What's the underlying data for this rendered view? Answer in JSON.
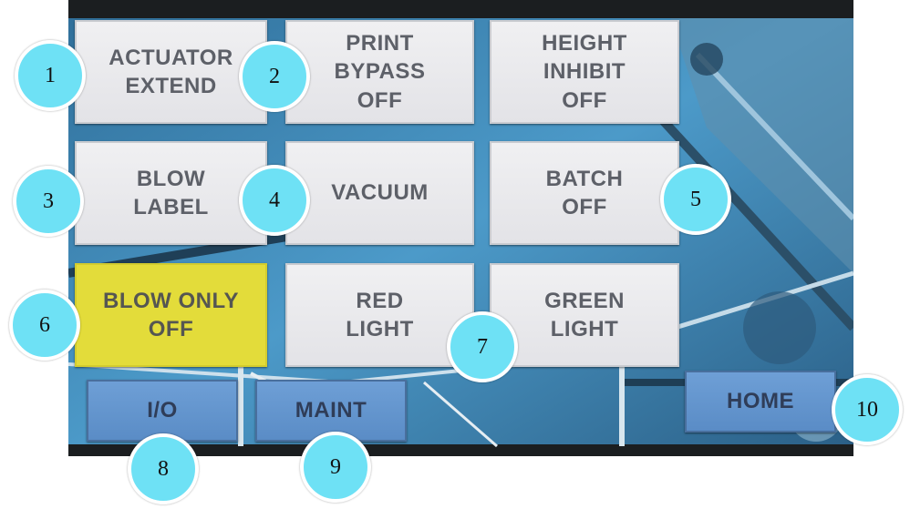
{
  "colors": {
    "tile": "#ebebee",
    "tile_text": "#5d6068",
    "yellow": "#e3dc3a",
    "blue_button": "#6596cf",
    "callout": "#6ee1f5"
  },
  "buttons": {
    "actuator_extend": "ACTUATOR\nEXTEND",
    "print_bypass": "PRINT\nBYPASS\nOFF",
    "height_inhibit": "HEIGHT\nINHIBIT\nOFF",
    "blow_label": "BLOW\nLABEL",
    "vacuum": "VACUUM",
    "batch": "BATCH\nOFF",
    "blow_only": "BLOW ONLY\nOFF",
    "red_light": "RED\nLIGHT",
    "green_light": "GREEN\nLIGHT",
    "io": "I/O",
    "maint": "MAINT",
    "home": "HOME"
  },
  "callouts": [
    "1",
    "2",
    "3",
    "4",
    "5",
    "6",
    "7",
    "8",
    "9",
    "10"
  ]
}
